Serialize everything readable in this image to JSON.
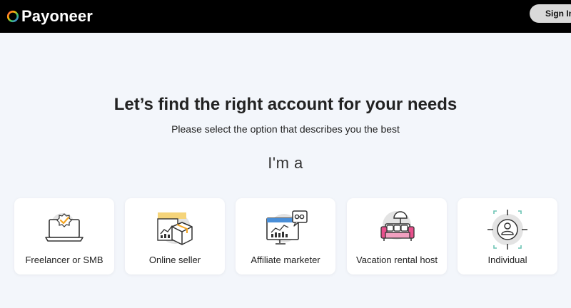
{
  "brand": {
    "name": "Payoneer"
  },
  "header": {
    "signin_label": "Sign In"
  },
  "main": {
    "headline": "Let’s find the right account for your needs",
    "subheadline": "Please select the option that describes you the best",
    "prompt": "I'm a"
  },
  "options": [
    {
      "label": "Freelancer or SMB",
      "icon": "laptop-badge-icon"
    },
    {
      "label": "Online seller",
      "icon": "package-chart-icon"
    },
    {
      "label": "Affiliate marketer",
      "icon": "monitor-chart-icon"
    },
    {
      "label": "Vacation rental host",
      "icon": "sofa-lamp-icon"
    },
    {
      "label": "Individual",
      "icon": "person-target-icon"
    }
  ],
  "colors": {
    "topbar": "#000000",
    "background": "#f3f6fb",
    "accent_orange": "#f5a623",
    "accent_pink": "#e8508c",
    "accent_blue": "#4a8fd8",
    "accent_teal": "#6cc4b4"
  }
}
